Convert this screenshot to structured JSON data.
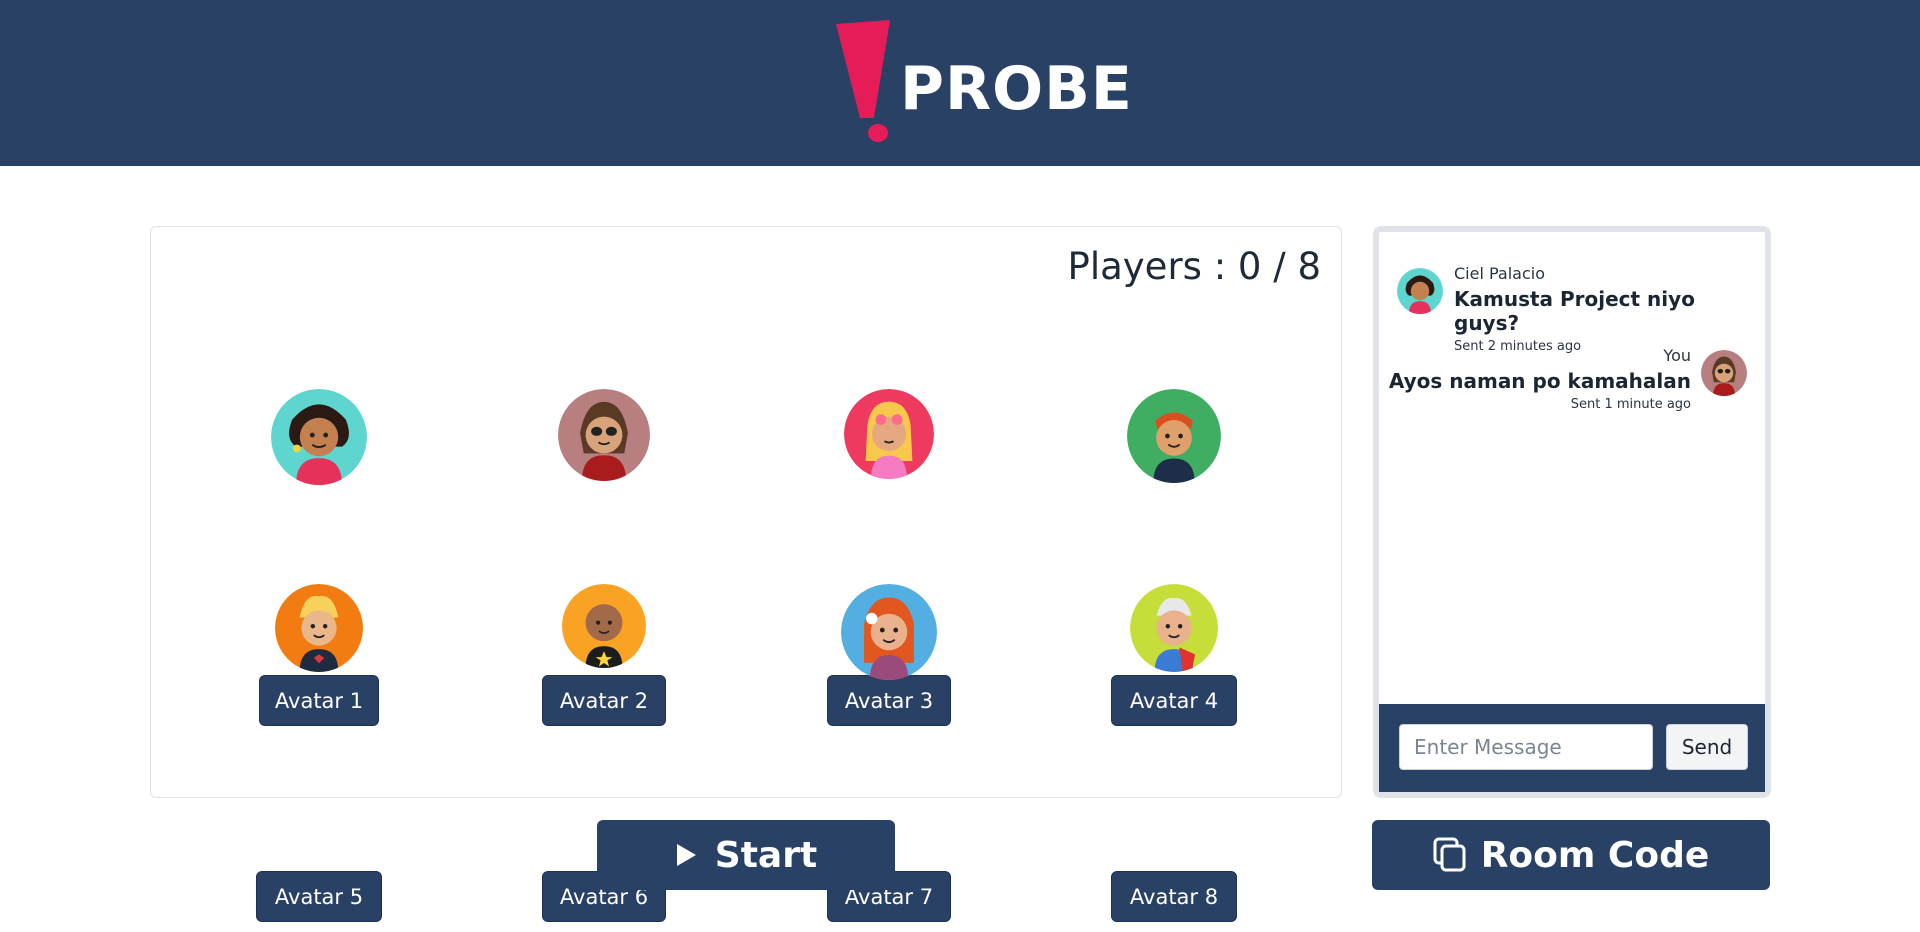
{
  "header": {
    "logo_text": "PROBE",
    "logo_icon": "exclamation-mark-icon",
    "accent_color": "#e61c58",
    "bg_color": "#2a4166"
  },
  "lobby": {
    "players_label": "Players : 0 / 8",
    "avatars": [
      {
        "label": "Avatar 1",
        "bg": "#5ed6cf"
      },
      {
        "label": "Avatar 2",
        "bg": "#b77f80"
      },
      {
        "label": "Avatar 3",
        "bg": "#ee3a5f"
      },
      {
        "label": "Avatar 4",
        "bg": "#3fae62"
      },
      {
        "label": "Avatar 5",
        "bg": "#f27b12"
      },
      {
        "label": "Avatar 6",
        "bg": "#f9a224"
      },
      {
        "label": "Avatar 7",
        "bg": "#53aee2"
      },
      {
        "label": "Avatar 8",
        "bg": "#c7dd3a"
      }
    ],
    "start_label": "Start",
    "start_icon": "play-icon"
  },
  "chat": {
    "messages": [
      {
        "sender": "Ciel Palacio",
        "text": "Kamusta Project niyo guys?",
        "time": "Sent 2 minutes ago",
        "avatar_bg": "#5ed6cf"
      },
      {
        "sender": "You",
        "text": "Ayos naman po kamahalan",
        "time": "Sent 1 minute ago",
        "avatar_bg": "#b77f80"
      }
    ],
    "input_placeholder": "Enter Message",
    "send_label": "Send"
  },
  "room_code": {
    "label": "Room Code",
    "icon": "copy-icon"
  }
}
